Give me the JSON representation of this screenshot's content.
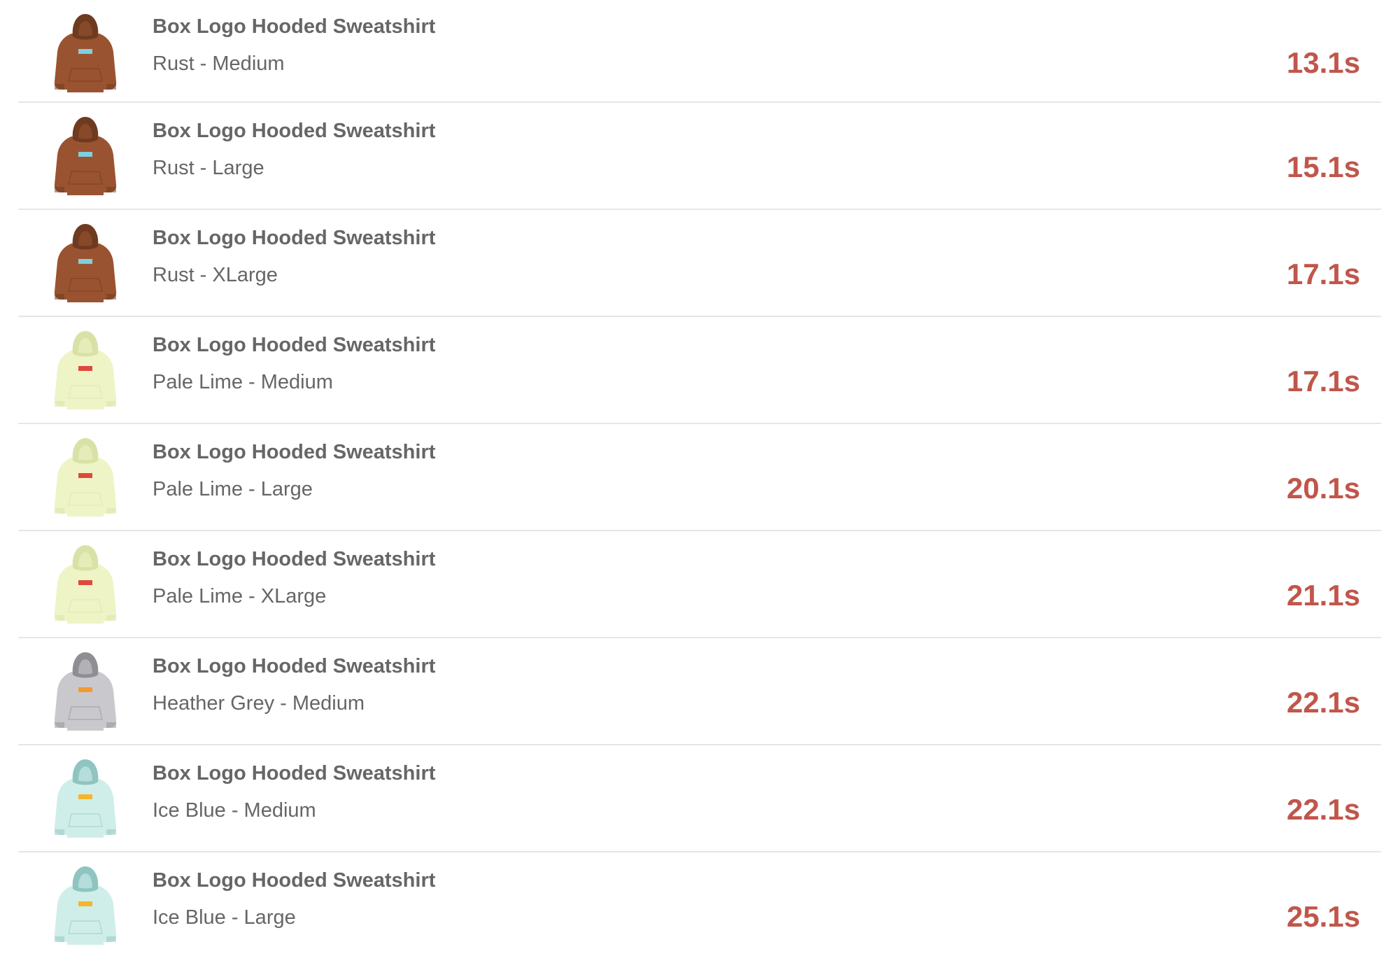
{
  "items": [
    {
      "title": "Box Logo Hooded Sweatshirt",
      "variant": "Rust - Medium",
      "time": "13.1s",
      "body_color": "#9a5330",
      "shade_color": "#6e3a20",
      "logo_color": "#7fd0de",
      "icon": "hoodie-icon"
    },
    {
      "title": "Box Logo Hooded Sweatshirt",
      "variant": "Rust - Large",
      "time": "15.1s",
      "body_color": "#9a5330",
      "shade_color": "#6e3a20",
      "logo_color": "#7fd0de",
      "icon": "hoodie-icon"
    },
    {
      "title": "Box Logo Hooded Sweatshirt",
      "variant": "Rust - XLarge",
      "time": "17.1s",
      "body_color": "#9a5330",
      "shade_color": "#6e3a20",
      "logo_color": "#7fd0de",
      "icon": "hoodie-icon"
    },
    {
      "title": "Box Logo Hooded Sweatshirt",
      "variant": "Pale Lime - Medium",
      "time": "17.1s",
      "body_color": "#eef4c6",
      "shade_color": "#d9e2a6",
      "logo_color": "#e0483c",
      "icon": "hoodie-icon"
    },
    {
      "title": "Box Logo Hooded Sweatshirt",
      "variant": "Pale Lime - Large",
      "time": "20.1s",
      "body_color": "#eef4c6",
      "shade_color": "#d9e2a6",
      "logo_color": "#e0483c",
      "icon": "hoodie-icon"
    },
    {
      "title": "Box Logo Hooded Sweatshirt",
      "variant": "Pale Lime - XLarge",
      "time": "21.1s",
      "body_color": "#eef4c6",
      "shade_color": "#d9e2a6",
      "logo_color": "#e0483c",
      "icon": "hoodie-icon"
    },
    {
      "title": "Box Logo Hooded Sweatshirt",
      "variant": "Heather Grey - Medium",
      "time": "22.1s",
      "body_color": "#c9c9cd",
      "shade_color": "#8e8e94",
      "logo_color": "#f29a2e",
      "icon": "hoodie-icon"
    },
    {
      "title": "Box Logo Hooded Sweatshirt",
      "variant": "Ice Blue - Medium",
      "time": "22.1s",
      "body_color": "#cfeeea",
      "shade_color": "#8fc4c0",
      "logo_color": "#f3b62c",
      "icon": "hoodie-icon"
    },
    {
      "title": "Box Logo Hooded Sweatshirt",
      "variant": "Ice Blue - Large",
      "time": "25.1s",
      "body_color": "#cfeeea",
      "shade_color": "#8fc4c0",
      "logo_color": "#f3b62c",
      "icon": "hoodie-icon"
    }
  ]
}
